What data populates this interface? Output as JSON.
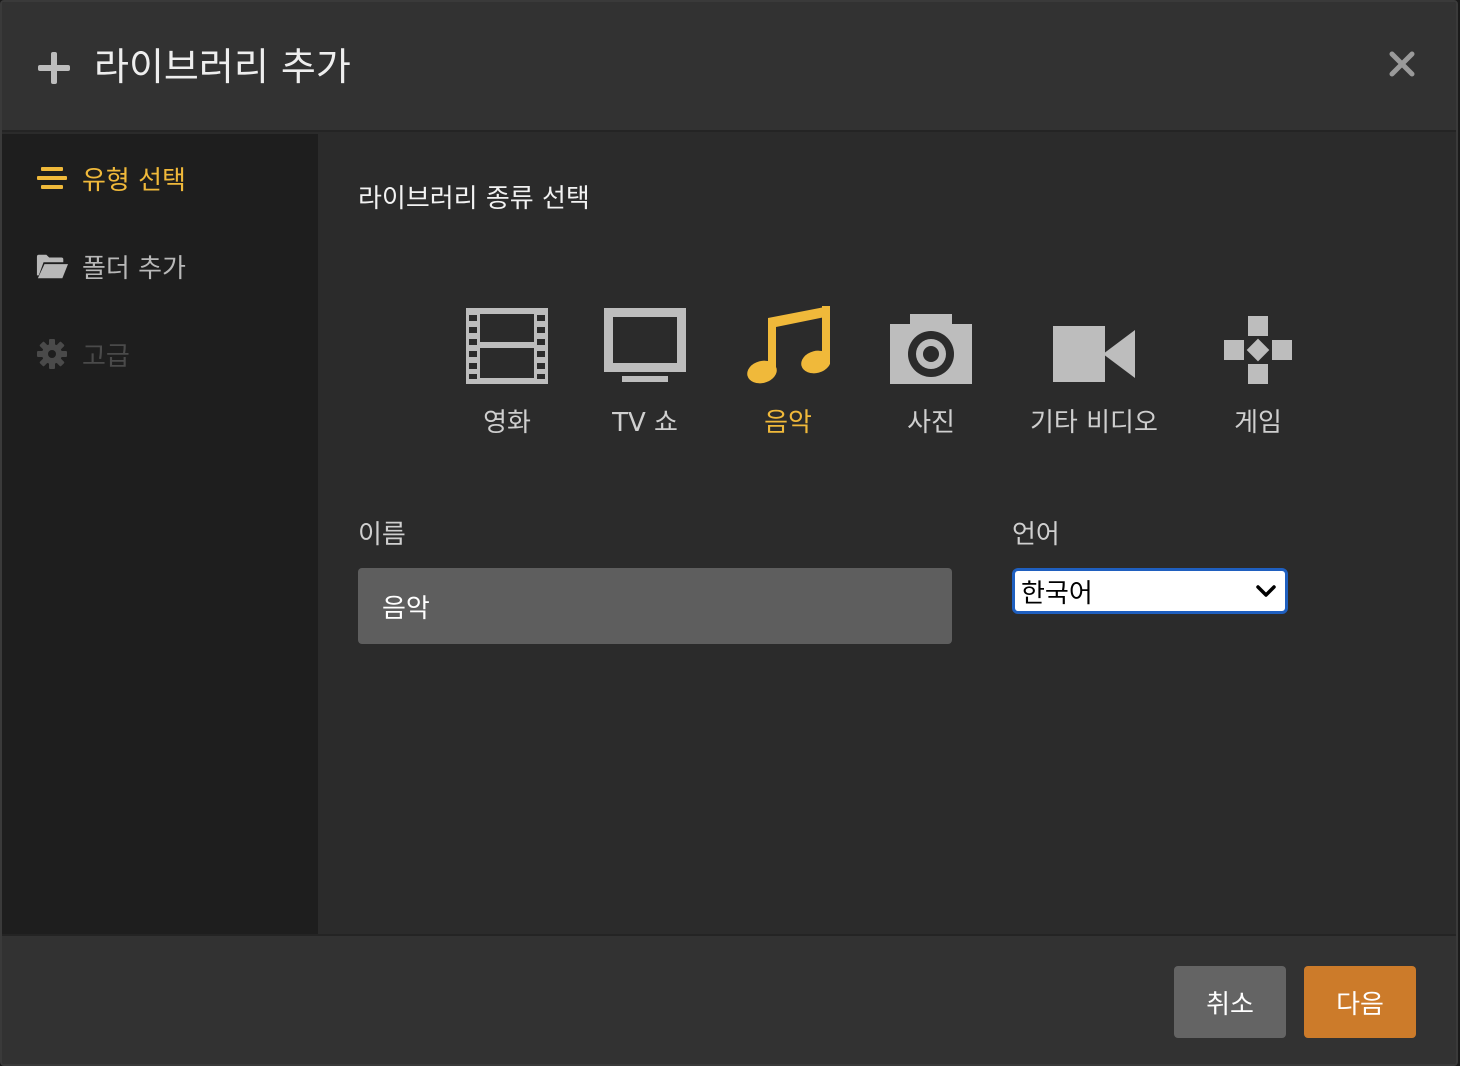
{
  "header": {
    "title": "라이브러리 추가",
    "plus_icon": "plus-icon",
    "close_icon": "close-icon"
  },
  "sidebar": {
    "items": [
      {
        "label": "유형 선택",
        "icon": "list-icon",
        "state": "active"
      },
      {
        "label": "폴더 추가",
        "icon": "folder-open-icon",
        "state": "normal"
      },
      {
        "label": "고급",
        "icon": "gear-icon",
        "state": "disabled"
      }
    ]
  },
  "main": {
    "subtitle": "라이브러리 종류 선택",
    "types": [
      {
        "label": "영화",
        "icon": "film-icon"
      },
      {
        "label": "TV 쇼",
        "icon": "tv-icon"
      },
      {
        "label": "음악",
        "icon": "music-note-icon",
        "selected": true
      },
      {
        "label": "사진",
        "icon": "camera-icon"
      },
      {
        "label": "기타 비디오",
        "icon": "video-camera-icon"
      },
      {
        "label": "게임",
        "icon": "gamepad-icon"
      }
    ],
    "name_label": "이름",
    "name_value": "음악",
    "language_label": "언어",
    "language_value": "한국어"
  },
  "footer": {
    "cancel_label": "취소",
    "next_label": "다음"
  },
  "colors": {
    "accent": "#f0b93a",
    "next_button": "#cc7b2a",
    "cancel_button": "#646464",
    "select_border": "#1f5fbf"
  }
}
